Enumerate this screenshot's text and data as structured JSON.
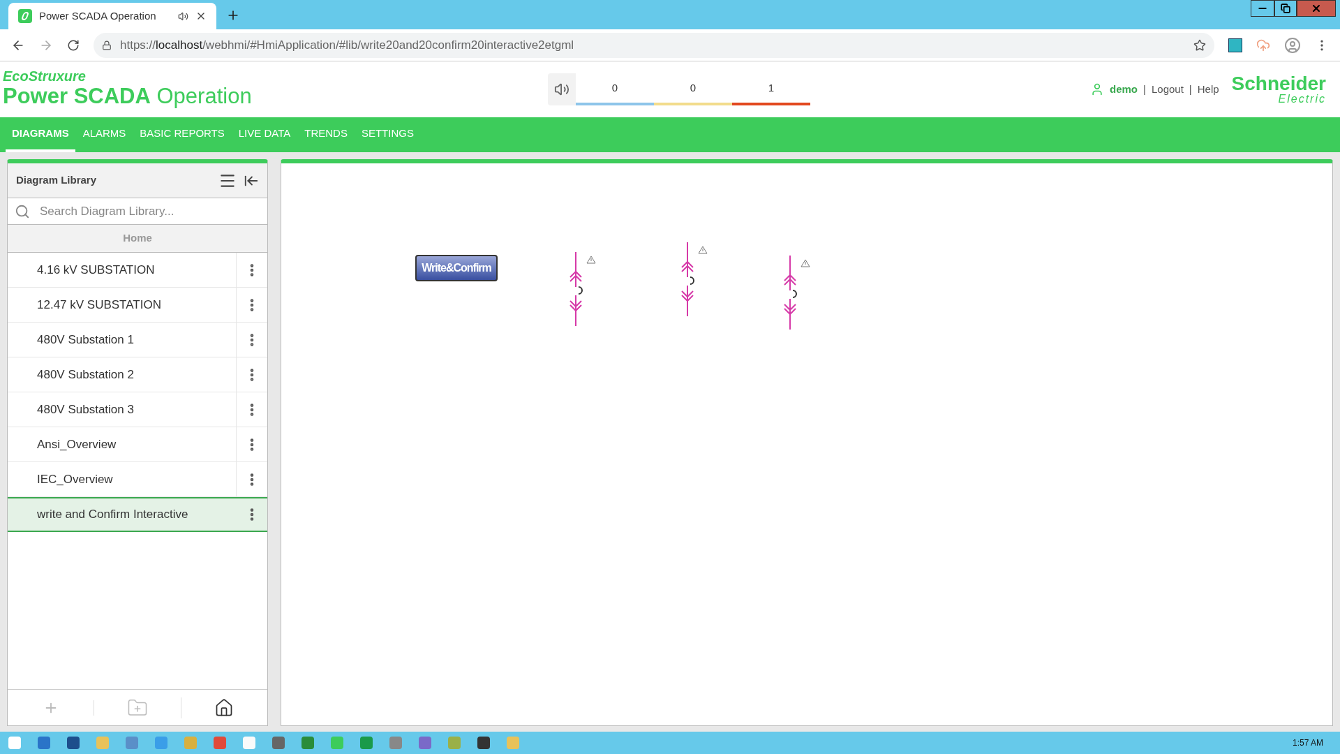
{
  "browser": {
    "tab": {
      "title": "Power SCADA Operation"
    },
    "url": {
      "scheme": "https://",
      "host": "localhost",
      "path": "/webhmi/#HmiApplication/#lib/write20and20confirm20interactive2etgml"
    }
  },
  "header": {
    "brand": "EcoStruxure",
    "product": "**Power SCADA** Operation",
    "alarm_counters": [
      {
        "value": "0",
        "color": "#8ec5ea"
      },
      {
        "value": "0",
        "color": "#f2dc8c"
      },
      {
        "value": "1",
        "color": "#e2481e"
      }
    ],
    "user": "demo",
    "links": [
      "Logout",
      "Help"
    ],
    "separator": "|",
    "vendor": {
      "name": "Schneider",
      "sub": "Electric"
    }
  },
  "nav": [
    {
      "label": "DIAGRAMS",
      "selected": true
    },
    {
      "label": "ALARMS",
      "selected": false
    },
    {
      "label": "BASIC REPORTS",
      "selected": false
    },
    {
      "label": "LIVE DATA",
      "selected": false
    },
    {
      "label": "TRENDS",
      "selected": false
    },
    {
      "label": "SETTINGS",
      "selected": false
    }
  ],
  "sidebar": {
    "title": "Diagram Library",
    "search": {
      "placeholder": "Search Diagram Library..."
    },
    "breadcrumb": "Home",
    "items": [
      {
        "label": "4.16 kV SUBSTATION",
        "selected": false
      },
      {
        "label": "12.47 kV SUBSTATION",
        "selected": false
      },
      {
        "label": "480V Substation 1",
        "selected": false
      },
      {
        "label": "480V Substation 2",
        "selected": false
      },
      {
        "label": "480V Substation 3",
        "selected": false
      },
      {
        "label": "Ansi_Overview",
        "selected": false
      },
      {
        "label": "IEC_Overview",
        "selected": false
      },
      {
        "label": "write and Confirm Interactive",
        "selected": true
      }
    ]
  },
  "canvas": {
    "button": "Write&Confirm"
  },
  "taskbar": {
    "clock": "1:57 AM"
  }
}
